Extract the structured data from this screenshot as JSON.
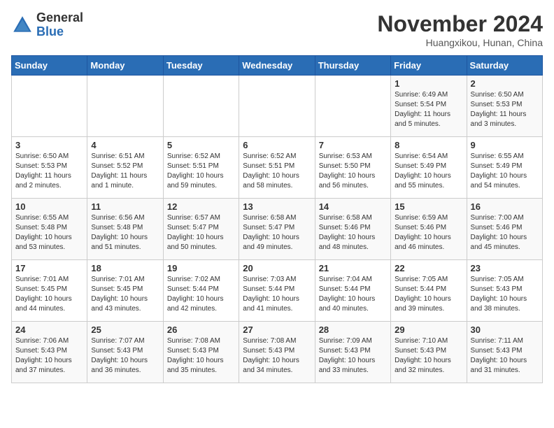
{
  "header": {
    "logo_general": "General",
    "logo_blue": "Blue",
    "month_title": "November 2024",
    "subtitle": "Huangxikou, Hunan, China"
  },
  "days_of_week": [
    "Sunday",
    "Monday",
    "Tuesday",
    "Wednesday",
    "Thursday",
    "Friday",
    "Saturday"
  ],
  "weeks": [
    [
      {
        "day": "",
        "info": ""
      },
      {
        "day": "",
        "info": ""
      },
      {
        "day": "",
        "info": ""
      },
      {
        "day": "",
        "info": ""
      },
      {
        "day": "",
        "info": ""
      },
      {
        "day": "1",
        "info": "Sunrise: 6:49 AM\nSunset: 5:54 PM\nDaylight: 11 hours and 5 minutes."
      },
      {
        "day": "2",
        "info": "Sunrise: 6:50 AM\nSunset: 5:53 PM\nDaylight: 11 hours and 3 minutes."
      }
    ],
    [
      {
        "day": "3",
        "info": "Sunrise: 6:50 AM\nSunset: 5:53 PM\nDaylight: 11 hours and 2 minutes."
      },
      {
        "day": "4",
        "info": "Sunrise: 6:51 AM\nSunset: 5:52 PM\nDaylight: 11 hours and 1 minute."
      },
      {
        "day": "5",
        "info": "Sunrise: 6:52 AM\nSunset: 5:51 PM\nDaylight: 10 hours and 59 minutes."
      },
      {
        "day": "6",
        "info": "Sunrise: 6:52 AM\nSunset: 5:51 PM\nDaylight: 10 hours and 58 minutes."
      },
      {
        "day": "7",
        "info": "Sunrise: 6:53 AM\nSunset: 5:50 PM\nDaylight: 10 hours and 56 minutes."
      },
      {
        "day": "8",
        "info": "Sunrise: 6:54 AM\nSunset: 5:49 PM\nDaylight: 10 hours and 55 minutes."
      },
      {
        "day": "9",
        "info": "Sunrise: 6:55 AM\nSunset: 5:49 PM\nDaylight: 10 hours and 54 minutes."
      }
    ],
    [
      {
        "day": "10",
        "info": "Sunrise: 6:55 AM\nSunset: 5:48 PM\nDaylight: 10 hours and 53 minutes."
      },
      {
        "day": "11",
        "info": "Sunrise: 6:56 AM\nSunset: 5:48 PM\nDaylight: 10 hours and 51 minutes."
      },
      {
        "day": "12",
        "info": "Sunrise: 6:57 AM\nSunset: 5:47 PM\nDaylight: 10 hours and 50 minutes."
      },
      {
        "day": "13",
        "info": "Sunrise: 6:58 AM\nSunset: 5:47 PM\nDaylight: 10 hours and 49 minutes."
      },
      {
        "day": "14",
        "info": "Sunrise: 6:58 AM\nSunset: 5:46 PM\nDaylight: 10 hours and 48 minutes."
      },
      {
        "day": "15",
        "info": "Sunrise: 6:59 AM\nSunset: 5:46 PM\nDaylight: 10 hours and 46 minutes."
      },
      {
        "day": "16",
        "info": "Sunrise: 7:00 AM\nSunset: 5:46 PM\nDaylight: 10 hours and 45 minutes."
      }
    ],
    [
      {
        "day": "17",
        "info": "Sunrise: 7:01 AM\nSunset: 5:45 PM\nDaylight: 10 hours and 44 minutes."
      },
      {
        "day": "18",
        "info": "Sunrise: 7:01 AM\nSunset: 5:45 PM\nDaylight: 10 hours and 43 minutes."
      },
      {
        "day": "19",
        "info": "Sunrise: 7:02 AM\nSunset: 5:44 PM\nDaylight: 10 hours and 42 minutes."
      },
      {
        "day": "20",
        "info": "Sunrise: 7:03 AM\nSunset: 5:44 PM\nDaylight: 10 hours and 41 minutes."
      },
      {
        "day": "21",
        "info": "Sunrise: 7:04 AM\nSunset: 5:44 PM\nDaylight: 10 hours and 40 minutes."
      },
      {
        "day": "22",
        "info": "Sunrise: 7:05 AM\nSunset: 5:44 PM\nDaylight: 10 hours and 39 minutes."
      },
      {
        "day": "23",
        "info": "Sunrise: 7:05 AM\nSunset: 5:43 PM\nDaylight: 10 hours and 38 minutes."
      }
    ],
    [
      {
        "day": "24",
        "info": "Sunrise: 7:06 AM\nSunset: 5:43 PM\nDaylight: 10 hours and 37 minutes."
      },
      {
        "day": "25",
        "info": "Sunrise: 7:07 AM\nSunset: 5:43 PM\nDaylight: 10 hours and 36 minutes."
      },
      {
        "day": "26",
        "info": "Sunrise: 7:08 AM\nSunset: 5:43 PM\nDaylight: 10 hours and 35 minutes."
      },
      {
        "day": "27",
        "info": "Sunrise: 7:08 AM\nSunset: 5:43 PM\nDaylight: 10 hours and 34 minutes."
      },
      {
        "day": "28",
        "info": "Sunrise: 7:09 AM\nSunset: 5:43 PM\nDaylight: 10 hours and 33 minutes."
      },
      {
        "day": "29",
        "info": "Sunrise: 7:10 AM\nSunset: 5:43 PM\nDaylight: 10 hours and 32 minutes."
      },
      {
        "day": "30",
        "info": "Sunrise: 7:11 AM\nSunset: 5:43 PM\nDaylight: 10 hours and 31 minutes."
      }
    ]
  ]
}
